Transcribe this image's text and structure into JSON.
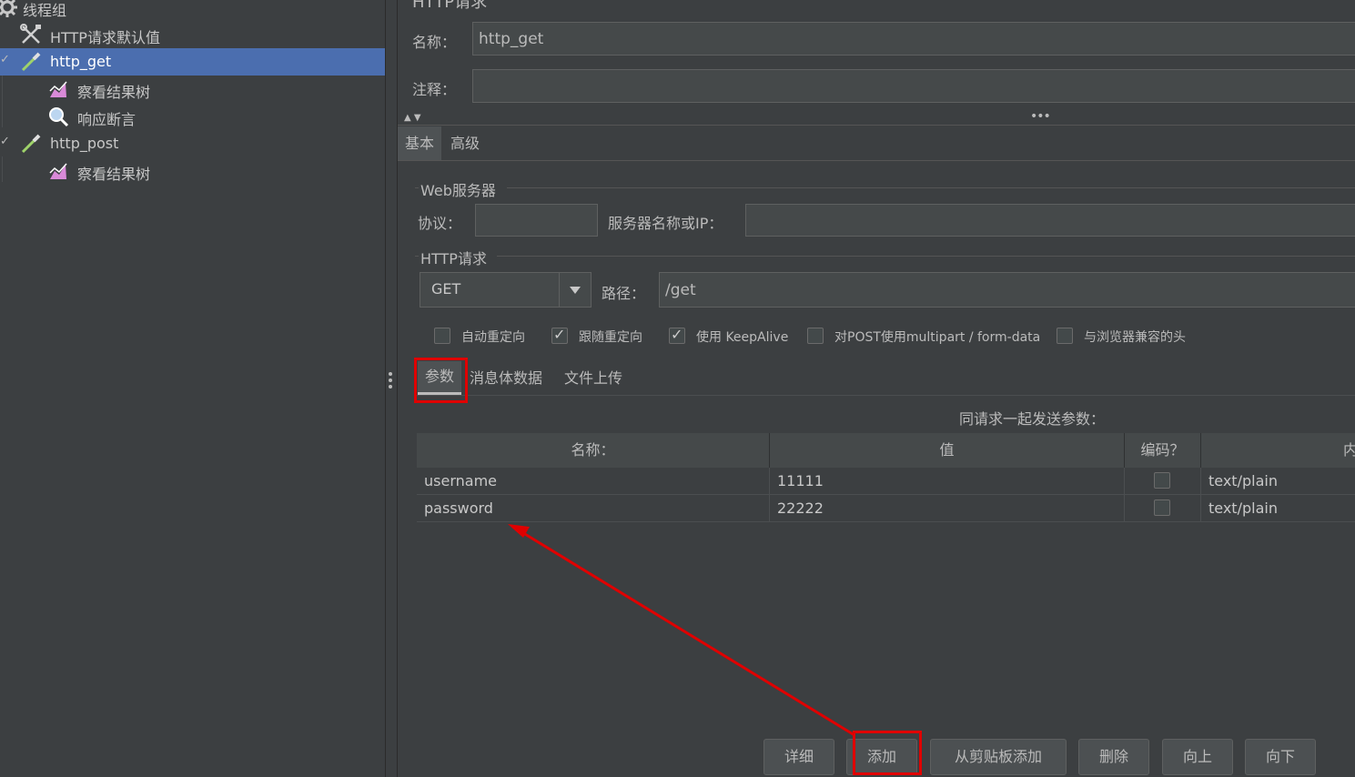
{
  "tree": {
    "items": [
      {
        "label": "线程组",
        "icon": "gear-icon"
      },
      {
        "label": "HTTP请求默认值",
        "icon": "tools-icon"
      },
      {
        "label": "http_get",
        "icon": "pipette-icon",
        "selected": true
      },
      {
        "label": "察看结果树",
        "icon": "chart-icon"
      },
      {
        "label": "响应断言",
        "icon": "magnifier-icon"
      },
      {
        "label": "http_post",
        "icon": "pipette-icon"
      },
      {
        "label": "察看结果树",
        "icon": "chart-icon"
      }
    ]
  },
  "panel": {
    "title": "HTTP请求",
    "name_label": "名称：",
    "name_value": "http_get",
    "comment_label": "注释：",
    "comment_value": "",
    "tabs": [
      "基本",
      "高级"
    ],
    "web_server_section": "Web服务器",
    "protocol_label": "协议：",
    "protocol_value": "",
    "server_label": "服务器名称或IP：",
    "server_value": "",
    "http_section": "HTTP请求",
    "method": "GET",
    "path_label": "路径：",
    "path_value": "/get",
    "options": [
      {
        "label": "自动重定向",
        "checked": false
      },
      {
        "label": "跟随重定向",
        "checked": true
      },
      {
        "label": "使用 KeepAlive",
        "checked": true
      },
      {
        "label": "对POST使用multipart / form-data",
        "checked": false
      },
      {
        "label": "与浏览器兼容的头",
        "checked": false
      }
    ],
    "sub_tabs": [
      "参数",
      "消息体数据",
      "文件上传"
    ],
    "params_caption": "同请求一起发送参数：",
    "table": {
      "headers": [
        "名称：",
        "值",
        "编码？",
        "内"
      ],
      "rows": [
        {
          "name": "username",
          "value": "11111",
          "encode": false,
          "content_type": "text/plain"
        },
        {
          "name": "password",
          "value": "22222",
          "encode": false,
          "content_type": "text/plain"
        }
      ]
    },
    "buttons": [
      "详细",
      "添加",
      "从剪贴板添加",
      "删除",
      "向上",
      "向下"
    ]
  },
  "colors": {
    "background": "#3c3f41",
    "selection": "#4b6eaf",
    "annotation": "#e00000"
  }
}
